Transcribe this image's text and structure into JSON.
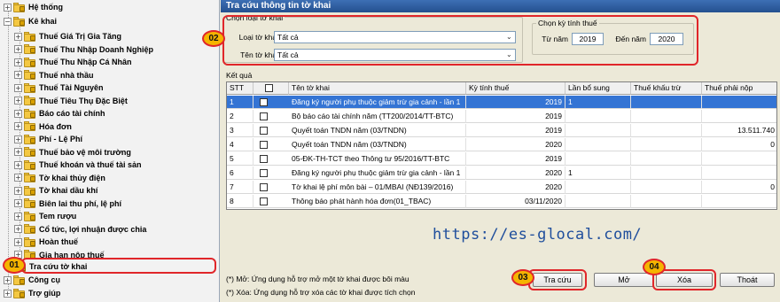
{
  "tree": {
    "top_items": [
      {
        "label": "Hệ thống",
        "expander": "+"
      },
      {
        "label": "Kê khai",
        "expander": "−"
      }
    ],
    "kekhai_children": [
      "Thuế Giá Trị Gia Tăng",
      "Thuế Thu Nhập Doanh Nghiệp",
      "Thuế Thu Nhập Cá Nhân",
      "Thuế nhà thầu",
      "Thuế Tài Nguyên",
      "Thuế Tiêu Thụ Đặc Biệt",
      "Báo cáo tài chính",
      "Hóa đơn",
      "Phí - Lệ Phí",
      "Thuế bảo vệ môi trường",
      "Thuế khoán và thuế tài sản",
      "Tờ khai thủy điện",
      "Tờ khai dầu khí",
      "Biên lai thu phí, lệ phí",
      "Tem rượu",
      "Cổ tức, lợi nhuận được chia",
      "Hoàn thuế",
      "Gia hạn nộp thuế"
    ],
    "bottom_items": [
      {
        "label": "Tra cứu tờ khai",
        "expander": ""
      },
      {
        "label": "Công cụ",
        "expander": "+"
      },
      {
        "label": "Trợ giúp",
        "expander": "+"
      }
    ]
  },
  "panel": {
    "title": "Tra cứu thông tin tờ khai",
    "filter_group_label": "Chọn loại tờ khai",
    "loai_label": "Loại tờ khai",
    "loai_value": "Tất cả",
    "ten_label": "Tên tờ khai",
    "ten_value": "Tất cả",
    "period_group_label": "Chọn kỳ tính thuế",
    "from_label": "Từ năm",
    "from_value": "2019",
    "to_label": "Đến năm",
    "to_value": "2020",
    "results_label": "Kết quả"
  },
  "grid": {
    "columns": [
      "STT",
      "",
      "Tên tờ khai",
      "Kỳ tính thuế",
      "Lần bổ sung",
      "Thuế khấu trừ",
      "Thuế phải nộp"
    ],
    "rows": [
      {
        "stt": "1",
        "name": "Đăng ký người phụ thuộc giảm trừ gia cảnh - lần 1",
        "period": "2019",
        "supplement": "1",
        "deduct": "",
        "payable": ""
      },
      {
        "stt": "2",
        "name": "Bộ báo cáo tài chính năm (TT200/2014/TT-BTC)",
        "period": "2019",
        "supplement": "",
        "deduct": "",
        "payable": ""
      },
      {
        "stt": "3",
        "name": "Quyết toán TNDN năm (03/TNDN)",
        "period": "2019",
        "supplement": "",
        "deduct": "",
        "payable": "13.511.740"
      },
      {
        "stt": "4",
        "name": "Quyết toán TNDN năm (03/TNDN)",
        "period": "2020",
        "supplement": "",
        "deduct": "",
        "payable": "0"
      },
      {
        "stt": "5",
        "name": "05-ĐK-TH-TCT theo Thông tư 95/2016/TT-BTC",
        "period": "2019",
        "supplement": "",
        "deduct": "",
        "payable": ""
      },
      {
        "stt": "6",
        "name": "Đăng ký người phụ thuộc giảm trừ gia cảnh - lần 1",
        "period": "2020",
        "supplement": "1",
        "deduct": "",
        "payable": ""
      },
      {
        "stt": "7",
        "name": "Tờ khai lệ phí môn bài – 01/MBAI (NĐ139/2016)",
        "period": "2020",
        "supplement": "",
        "deduct": "",
        "payable": "0"
      },
      {
        "stt": "8",
        "name": "Thông báo phát hành hóa đơn(01_TBAC)",
        "period": "03/11/2020",
        "supplement": "",
        "deduct": "",
        "payable": ""
      }
    ],
    "selected_row": 0
  },
  "notes": {
    "open": "(*) Mở:  Ứng dụng hỗ trợ mở một tờ khai được bôi màu",
    "delete": "(*) Xóa: Ứng dụng hỗ trợ xóa các tờ khai được tích chọn"
  },
  "buttons": {
    "search": "Tra cứu",
    "open": "Mở",
    "delete": "Xóa",
    "exit": "Thoát"
  },
  "annotations": {
    "badge_01": "01",
    "badge_02": "02",
    "badge_03": "03",
    "badge_04": "04",
    "url": "https://es-glocal.com/"
  },
  "colors": {
    "highlight_red": "#e0262a",
    "badge_fill": "#f5b400",
    "selection_blue": "#3474d4",
    "url_blue": "#1f4e9c"
  }
}
